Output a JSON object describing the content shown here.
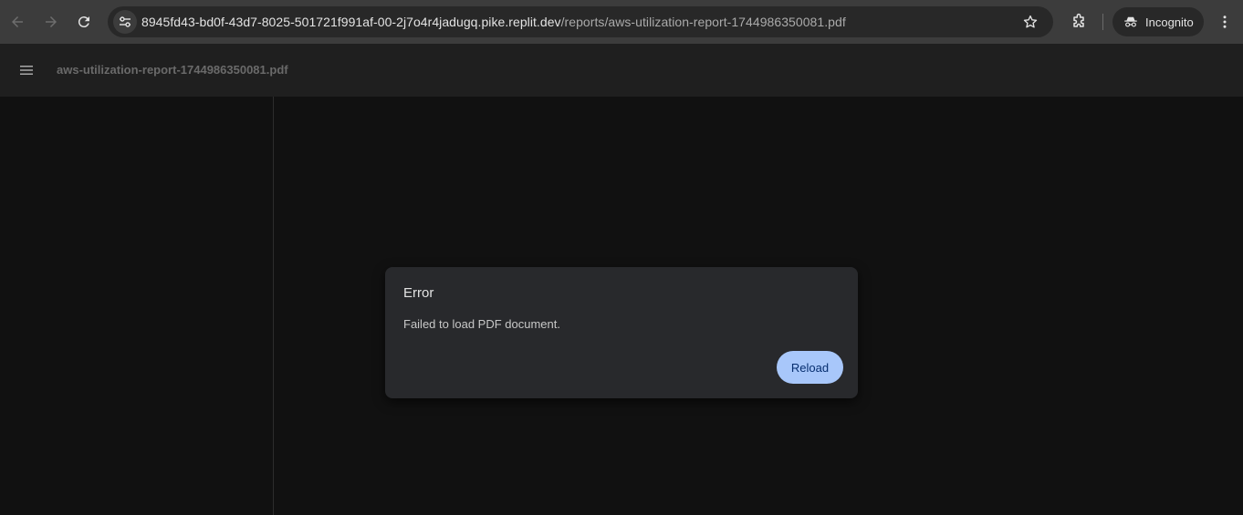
{
  "browser": {
    "url_host": "8945fd43-bd0f-43d7-8025-501721f991af-00-2j7o4r4jadugq.pike.replit.dev",
    "url_path": "/reports/aws-utilization-report-1744986350081.pdf",
    "incognito_label": "Incognito",
    "icons": [
      "back-icon",
      "forward-icon",
      "reload-icon",
      "site-info-icon",
      "star-icon",
      "extensions-icon",
      "incognito-icon",
      "more-icon"
    ]
  },
  "viewer": {
    "document_title": "aws-utilization-report-1744986350081.pdf"
  },
  "dialog": {
    "title": "Error",
    "message": "Failed to load PDF document.",
    "reload_label": "Reload"
  },
  "colors": {
    "toolbar": "#3c3c3c",
    "background": "#111111",
    "dialog": "#28292c",
    "accent": "#a8c7fa"
  }
}
